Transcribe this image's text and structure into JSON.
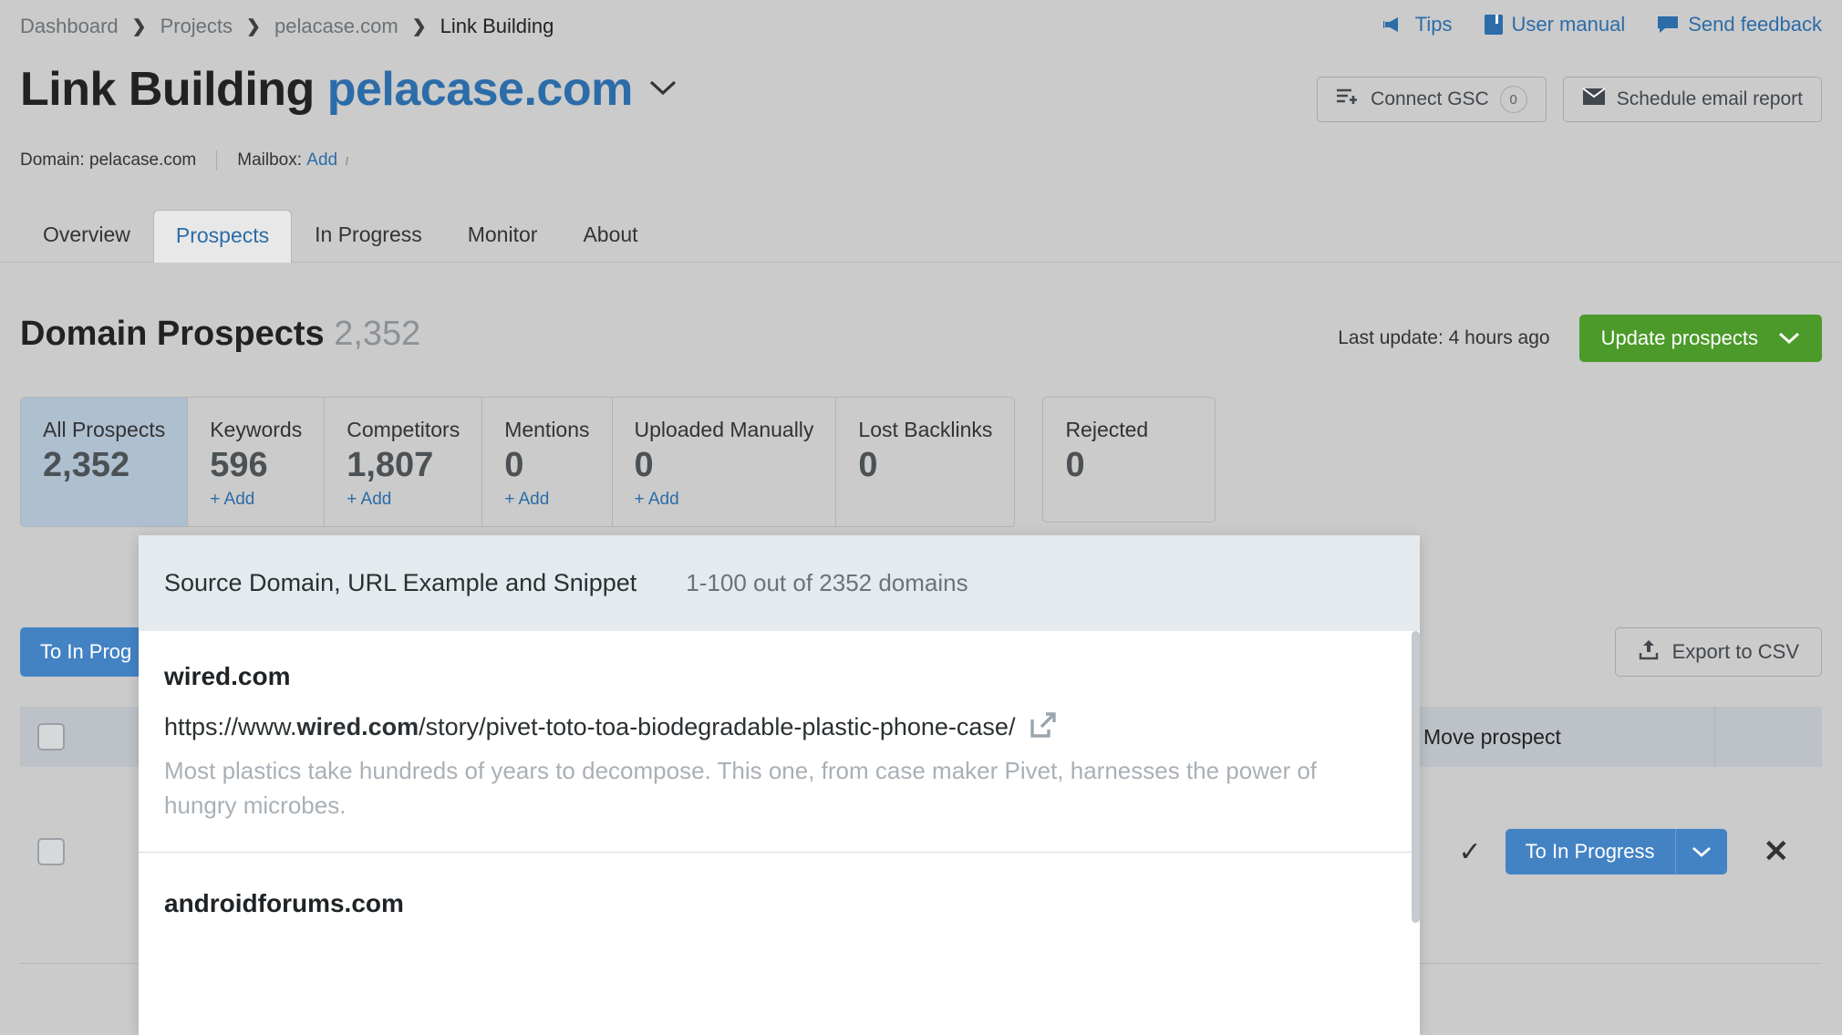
{
  "breadcrumb": {
    "items": [
      {
        "label": "Dashboard"
      },
      {
        "label": "Projects"
      },
      {
        "label": "pelacase.com"
      },
      {
        "label": "Link Building"
      }
    ],
    "separator": "❯"
  },
  "top_links": [
    {
      "label": "Tips",
      "icon": "megaphone-icon"
    },
    {
      "label": "User manual",
      "icon": "book-icon"
    },
    {
      "label": "Send feedback",
      "icon": "speech-bubble-icon"
    }
  ],
  "header": {
    "title_prefix": "Link Building",
    "title_domain": "pelacase.com",
    "caret": "⌄",
    "connect_gsc_label": "Connect GSC",
    "connect_gsc_badge": "0",
    "schedule_label": "Schedule email report"
  },
  "meta": {
    "domain_text": "Domain: pelacase.com",
    "mailbox_label": "Mailbox:",
    "mailbox_link": "Add",
    "info_glyph": "ı"
  },
  "tabs": [
    {
      "label": "Overview",
      "active": false
    },
    {
      "label": "Prospects",
      "active": true
    },
    {
      "label": "In Progress",
      "active": false
    },
    {
      "label": "Monitor",
      "active": false
    },
    {
      "label": "About",
      "active": false
    }
  ],
  "section": {
    "heading": "Domain Prospects",
    "heading_count": "2,352",
    "last_update": "Last update: 4 hours ago",
    "update_button": "Update prospects",
    "update_caret": "⌄"
  },
  "cards": [
    {
      "label": "All Prospects",
      "value": "2,352",
      "add": null,
      "selected": true
    },
    {
      "label": "Keywords",
      "value": "596",
      "add": "+ Add",
      "selected": false
    },
    {
      "label": "Competitors",
      "value": "1,807",
      "add": "+ Add",
      "selected": false
    },
    {
      "label": "Mentions",
      "value": "0",
      "add": "+ Add",
      "selected": false
    },
    {
      "label": "Uploaded Manually",
      "value": "0",
      "add": "+ Add",
      "selected": false
    },
    {
      "label": "Lost Backlinks",
      "value": "0",
      "add": null,
      "selected": false
    }
  ],
  "card_rejected": {
    "label": "Rejected",
    "value": "0"
  },
  "actions": {
    "to_in_progress_label": "To In Prog",
    "export_label": "Export to CSV"
  },
  "table": {
    "move_prospect_header": "Move prospect",
    "row": {
      "to_in_progress_label": "To In Progress",
      "dropdown_caret": "⌄",
      "close_glyph": "✕",
      "tick_glyph": "✓"
    }
  },
  "overlay": {
    "title": "Source Domain, URL Example and Snippet",
    "count": "1-100 out of 2352 domains",
    "items": [
      {
        "domain": "wired.com",
        "url_prefix": "https://www.",
        "url_bold": "wired.com",
        "url_suffix": "/story/pivet-toto-toa-biodegradable-plastic-phone-case/",
        "external_icon": "external-link-icon",
        "snippet": "Most plastics take hundreds of years to decompose. This one, from case maker Pivet, harnesses the power of hungry microbes."
      },
      {
        "domain": "androidforums.com"
      }
    ]
  },
  "colors": {
    "page_bg": "#cbcbcb",
    "link_blue": "#2c6ca8",
    "button_blue": "#4383c4",
    "button_green": "#4c9a2a",
    "card_selected": "#aebfd0",
    "overlay_header": "#e4eaed"
  }
}
